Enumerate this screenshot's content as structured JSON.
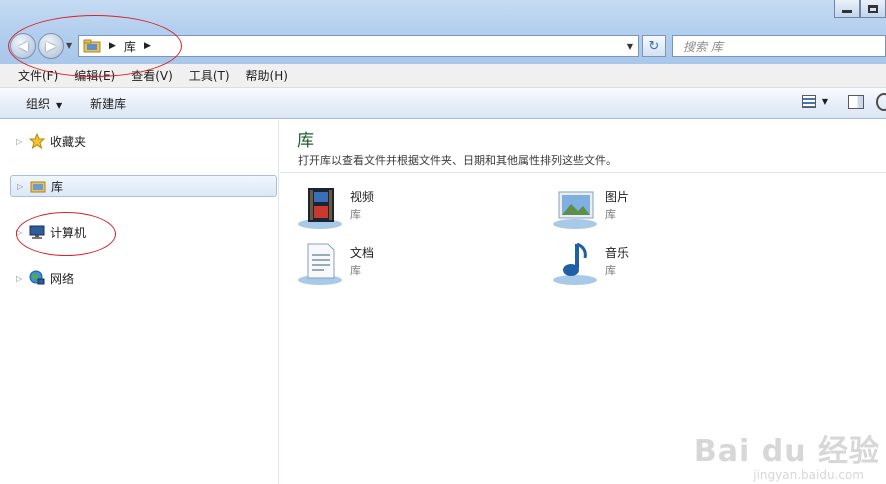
{
  "window": {
    "minimize_label": "",
    "maximize_label": "",
    "close_label": ""
  },
  "address_bar": {
    "crumbs": [
      "库"
    ]
  },
  "search": {
    "placeholder": "搜索 库"
  },
  "menu": [
    "文件(F)",
    "编辑(E)",
    "查看(V)",
    "工具(T)",
    "帮助(H)"
  ],
  "commands": {
    "organize": "组织",
    "new_library": "新建库"
  },
  "sidebar": {
    "items": [
      {
        "label": "收藏夹",
        "icon": "star-icon"
      },
      {
        "label": "库",
        "icon": "library-folder-icon"
      },
      {
        "label": "计算机",
        "icon": "computer-icon"
      },
      {
        "label": "网络",
        "icon": "network-icon"
      }
    ]
  },
  "content": {
    "title": "库",
    "description": "打开库以查看文件并根据文件夹、日期和其他属性排列这些文件。",
    "libraries": [
      {
        "name": "视频",
        "type": "库",
        "icon": "video-library-icon"
      },
      {
        "name": "图片",
        "type": "库",
        "icon": "pictures-library-icon"
      },
      {
        "name": "文档",
        "type": "库",
        "icon": "documents-library-icon"
      },
      {
        "name": "音乐",
        "type": "库",
        "icon": "music-library-icon"
      }
    ]
  },
  "watermark": {
    "brand": "Bai du 经验",
    "url": "jingyan.baidu.com"
  },
  "colors": {
    "title_green": "#1e5d2d",
    "annotation_red": "#d8232a",
    "selection_bg": "#dbe8f7"
  }
}
